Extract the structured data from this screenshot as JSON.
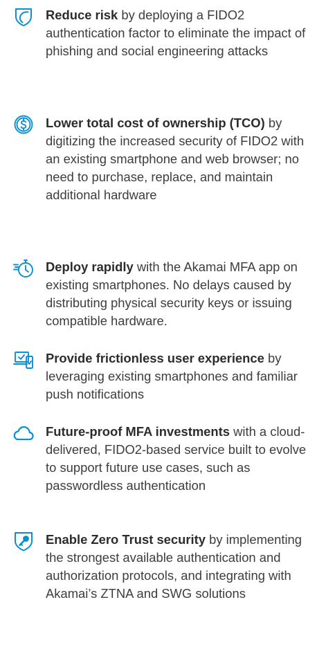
{
  "accent_color": "#0a8fd4",
  "benefits": [
    {
      "icon": "shield-icon",
      "lead": "Reduce risk",
      "body": " by deploying a FIDO2 authentication factor to eliminate the impact of phishing and social engineering attacks"
    },
    {
      "icon": "dollar-coin-icon",
      "lead": "Lower total cost of ownership (TCO)",
      "body": " by digitizing the increased security of FIDO2 with an existing smartphone and web browser; no need to purchase, replace, and maintain additional hardware"
    },
    {
      "icon": "stopwatch-icon",
      "lead": "Deploy rapidly",
      "body": " with the Akamai MFA app on existing smartphones. No delays caused by distributing physical security keys or issuing compatible hardware."
    },
    {
      "icon": "devices-check-icon",
      "lead": "Provide frictionless user experience",
      "body": " by leveraging existing smartphones and familiar push notifications"
    },
    {
      "icon": "cloud-icon",
      "lead": "Future-proof MFA investments",
      "body": " with a cloud-delivered, FIDO2-based service built to evolve to support future use cases, such as passwordless authentication"
    },
    {
      "icon": "shield-key-icon",
      "lead": "Enable Zero Trust security",
      "body": " by implementing the strongest available authentication and authorization protocols, and integrating with Akamai’s ZTNA and SWG solutions"
    }
  ]
}
